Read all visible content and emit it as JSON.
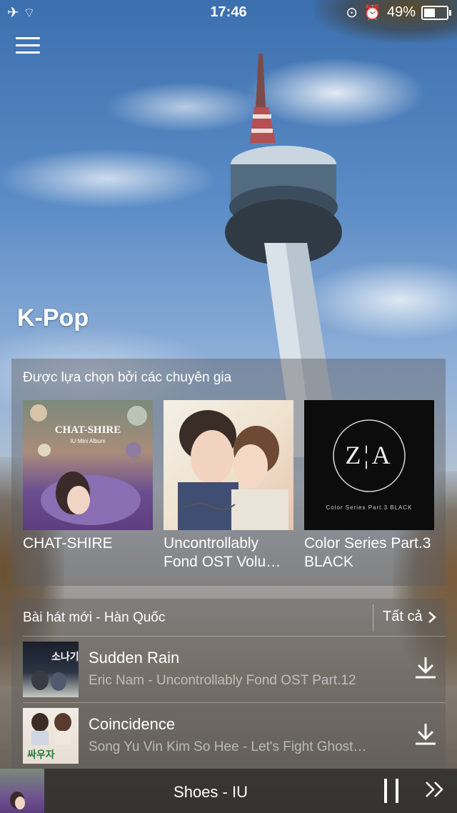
{
  "status_bar": {
    "time": "17:46",
    "battery": "49%"
  },
  "genre_title": "K-Pop",
  "featured": {
    "title": "Được lựa chọn bởi các chuyên gia",
    "albums": [
      {
        "name": "CHAT-SHIRE",
        "cover_text": "CHAT-SHIRE",
        "cover_sub": "IU Mini Album"
      },
      {
        "name": "Uncontrollably Fond OST Volu…"
      },
      {
        "name": "Color Series Part.3 BLACK",
        "cover_text": "Z¦A",
        "cover_sub": "Color Series Part.3 BLACK"
      }
    ]
  },
  "new_songs": {
    "title": "Bài hát mới - Hàn Quốc",
    "see_all": "Tất cả",
    "songs": [
      {
        "title": "Sudden Rain",
        "artist": "Eric Nam - Uncontrollably Fond OST Part.12"
      },
      {
        "title": "Coincidence",
        "artist": "Song Yu Vin Kim So Hee - Let's Fight Ghost…"
      }
    ]
  },
  "now_playing": {
    "title": "Shoes - IU"
  }
}
